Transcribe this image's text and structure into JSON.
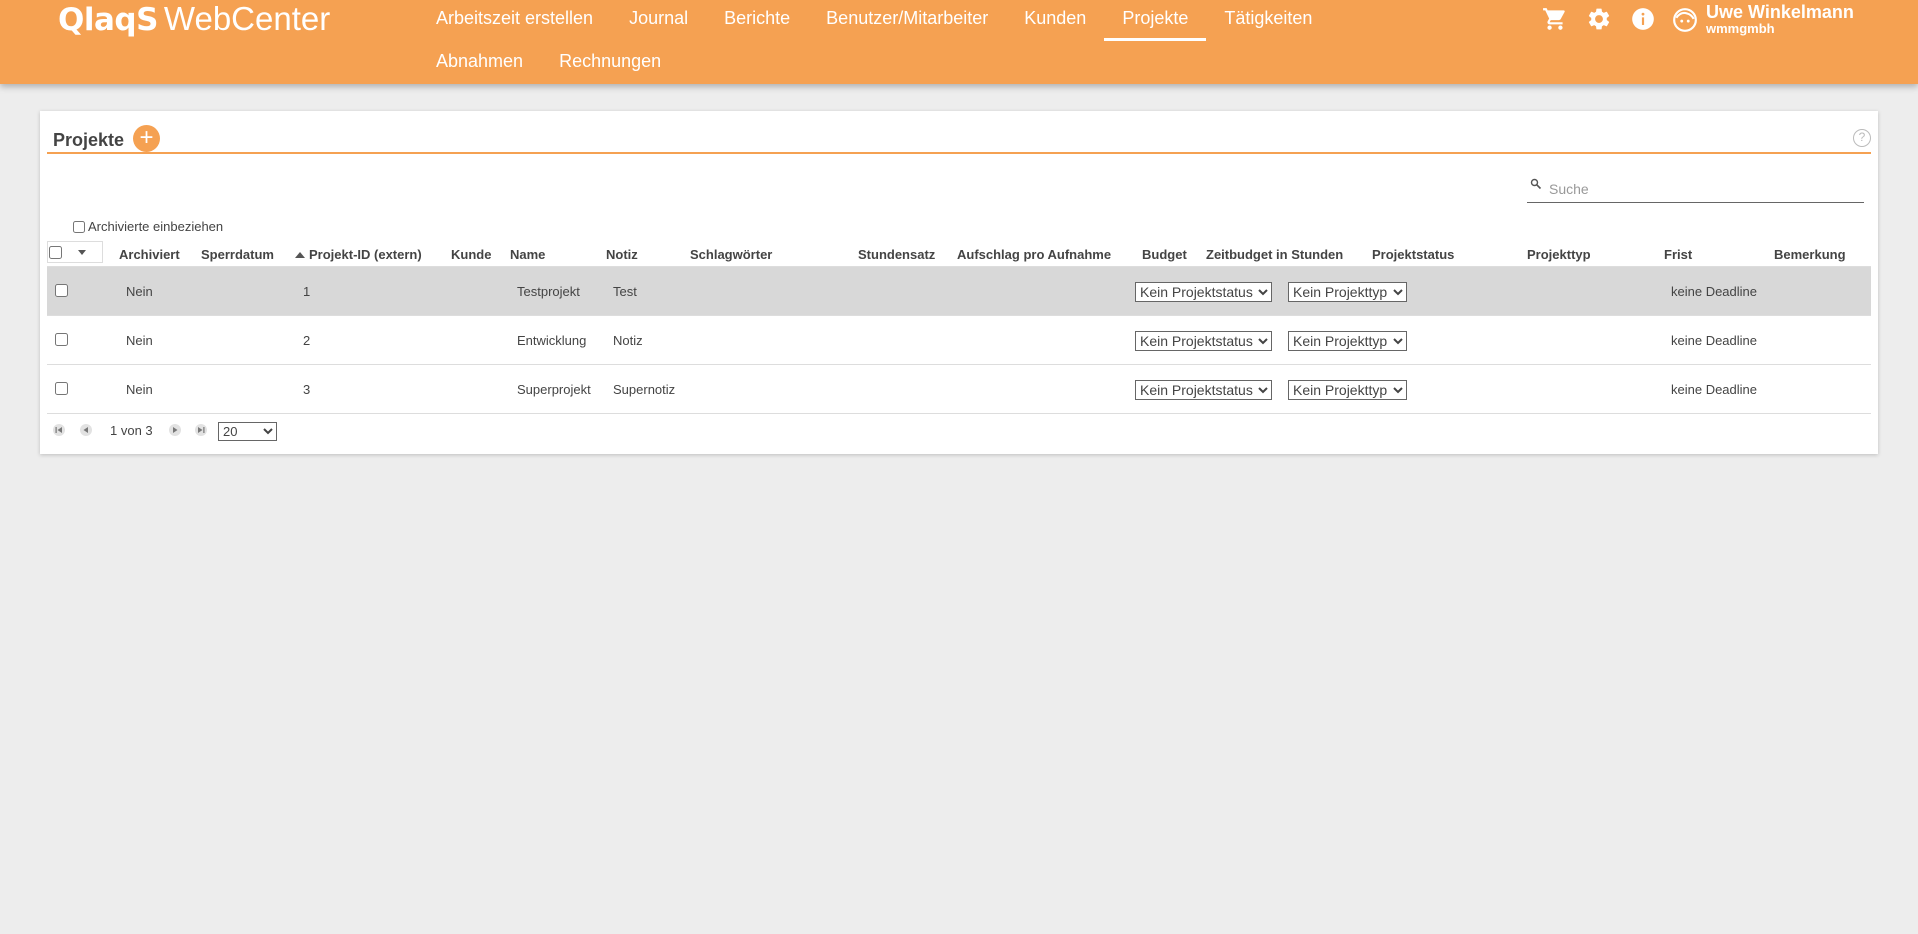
{
  "app": {
    "brand": "QlaqS",
    "product": "WebCenter"
  },
  "nav": {
    "row1": [
      {
        "label": "Arbeitszeit erstellen"
      },
      {
        "label": "Journal"
      },
      {
        "label": "Berichte"
      },
      {
        "label": "Benutzer/Mitarbeiter"
      },
      {
        "label": "Kunden"
      },
      {
        "label": "Projekte",
        "active": true
      },
      {
        "label": "Tätigkeiten"
      }
    ],
    "row2": [
      {
        "label": "Abnahmen"
      },
      {
        "label": "Rechnungen"
      }
    ]
  },
  "toolbar_icons": [
    "cart-icon",
    "gear-icon",
    "info-icon"
  ],
  "user": {
    "name": "Uwe Winkelmann",
    "company": "wmmgmbh"
  },
  "panel": {
    "title": "Projekte",
    "add_symbol": "+",
    "help_symbol": "?"
  },
  "search": {
    "placeholder": "Suche",
    "value": ""
  },
  "filters": {
    "include_archived_label": "Archivierte einbeziehen",
    "include_archived": false
  },
  "table": {
    "columns": {
      "archived": "Archiviert",
      "lock_date": "Sperrdatum",
      "project_id": "Projekt-ID (extern)",
      "customer": "Kunde",
      "name": "Name",
      "note": "Notiz",
      "tags": "Schlagwörter",
      "hourly_rate": "Stundensatz",
      "surcharge": "Aufschlag pro Aufnahme",
      "budget": "Budget",
      "time_budget": "Zeitbudget in Stunden",
      "status": "Projektstatus",
      "type": "Projekttyp",
      "deadline": "Frist",
      "remark": "Bemerkung"
    },
    "sort": {
      "column": "project_id",
      "direction": "asc"
    },
    "rows": [
      {
        "archived": "Nein",
        "project_id": "1",
        "name": "Testprojekt",
        "note": "Test",
        "status": "Kein Projektstatus",
        "type": "Kein Projekttyp",
        "deadline": "keine Deadline",
        "highlighted": true
      },
      {
        "archived": "Nein",
        "project_id": "2",
        "name": "Entwicklung",
        "note": "Notiz",
        "status": "Kein Projektstatus",
        "type": "Kein Projekttyp",
        "deadline": "keine Deadline",
        "highlighted": false
      },
      {
        "archived": "Nein",
        "project_id": "3",
        "name": "Superprojekt",
        "note": "Supernotiz",
        "status": "Kein Projektstatus",
        "type": "Kein Projekttyp",
        "deadline": "keine Deadline",
        "highlighted": false
      }
    ]
  },
  "pagination": {
    "page_text": "1 von 3",
    "page_size": "20"
  },
  "colors": {
    "accent": "#f5a152",
    "selected_row": "#d8d8d8",
    "background": "#ededed"
  }
}
